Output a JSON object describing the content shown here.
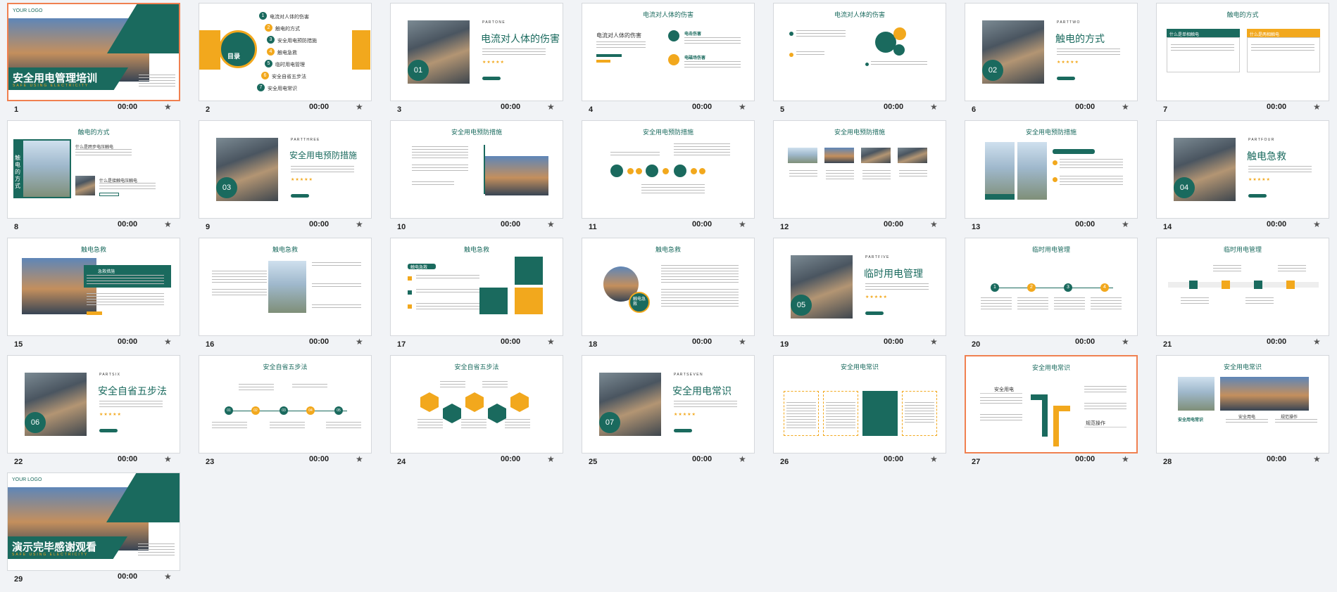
{
  "slides": [
    {
      "num": "1",
      "time": "00:00",
      "title": "安全用电管理培训",
      "subtitle": "SAFE USING ELECTRICITY",
      "logo": "YOUR    LOGO"
    },
    {
      "num": "2",
      "time": "00:00",
      "badge": "目录",
      "items": [
        "电流对人体的伤害",
        "触电的方式",
        "安全用电预防措施",
        "触电急救",
        "临时用电管理",
        "安全自省五步法",
        "安全用电常识"
      ]
    },
    {
      "num": "3",
      "time": "00:00",
      "part": "P A R T   O N E",
      "title": "电流对人体的伤害",
      "n": "01"
    },
    {
      "num": "4",
      "time": "00:00",
      "title": "电流对人体的伤害",
      "sub1": "电流对人体的伤害",
      "h1": "电击伤害",
      "h2": "电磁场伤害"
    },
    {
      "num": "5",
      "time": "00:00",
      "title": "电流对人体的伤害"
    },
    {
      "num": "6",
      "time": "00:00",
      "part": "P A R T   T W O",
      "title": "触电的方式",
      "n": "02"
    },
    {
      "num": "7",
      "time": "00:00",
      "title": "触电的方式",
      "b1": "什么是单相触电",
      "b2": "什么是两相触电"
    },
    {
      "num": "8",
      "time": "00:00",
      "title": "触电的方式",
      "vert": "触电的方式",
      "q1": "什么是跨步电压触电",
      "q2": "什么是接触电压触电"
    },
    {
      "num": "9",
      "time": "00:00",
      "part": "P A R T   T H R E E",
      "title": "安全用电预防措施",
      "n": "03"
    },
    {
      "num": "10",
      "time": "00:00",
      "title": "安全用电预防措施"
    },
    {
      "num": "11",
      "time": "00:00",
      "title": "安全用电预防措施"
    },
    {
      "num": "12",
      "time": "00:00",
      "title": "安全用电预防措施"
    },
    {
      "num": "13",
      "time": "00:00",
      "title": "安全用电预防措施"
    },
    {
      "num": "14",
      "time": "00:00",
      "part": "P A R T   F O U R",
      "title": "触电急救",
      "n": "04"
    },
    {
      "num": "15",
      "time": "00:00",
      "title": "触电急救",
      "box": "急救措施"
    },
    {
      "num": "16",
      "time": "00:00",
      "title": "触电急救"
    },
    {
      "num": "17",
      "time": "00:00",
      "title": "触电急救",
      "tag": "触电急救"
    },
    {
      "num": "18",
      "time": "00:00",
      "title": "触电急救",
      "badge": "触电急救"
    },
    {
      "num": "19",
      "time": "00:00",
      "part": "P A R T   F I V E",
      "title": "临时用电管理",
      "n": "05"
    },
    {
      "num": "20",
      "time": "00:00",
      "title": "临时用电管理",
      "steps": [
        "1",
        "2",
        "3",
        "4"
      ]
    },
    {
      "num": "21",
      "time": "00:00",
      "title": "临时用电管理"
    },
    {
      "num": "22",
      "time": "00:00",
      "part": "P A R T   S I X",
      "title": "安全自省五步法",
      "n": "06"
    },
    {
      "num": "23",
      "time": "00:00",
      "title": "安全自省五步法",
      "steps": [
        "01",
        "02",
        "03",
        "04",
        "05"
      ]
    },
    {
      "num": "24",
      "time": "00:00",
      "title": "安全自省五步法"
    },
    {
      "num": "25",
      "time": "00:00",
      "part": "P A R T   S E V E N",
      "title": "安全用电常识",
      "n": "07"
    },
    {
      "num": "26",
      "time": "00:00",
      "title": "安全用电常识"
    },
    {
      "num": "27",
      "time": "00:00",
      "title": "安全用电常识",
      "left": "安全用电",
      "right": "规范操作"
    },
    {
      "num": "28",
      "time": "00:00",
      "title": "安全用电常识",
      "a": "安全用电常识",
      "b": "安全用电",
      "c": "规范操作"
    },
    {
      "num": "29",
      "time": "00:00",
      "title": "演示完毕感谢观看",
      "subtitle": "SAFE USING ELECTRICITY",
      "logo": "YOUR    LOGO"
    }
  ],
  "selected": "1"
}
